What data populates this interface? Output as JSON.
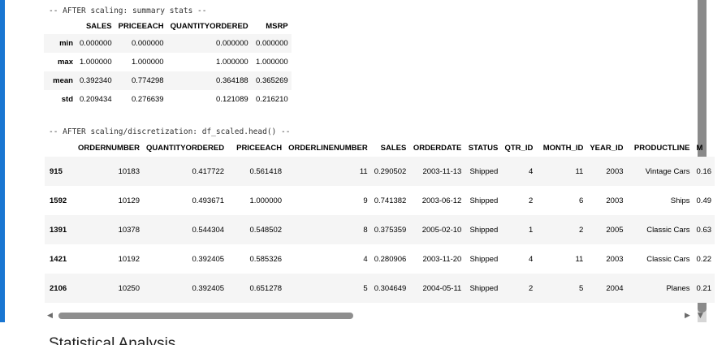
{
  "summary": {
    "label": "-- AFTER scaling: summary stats --",
    "columns": [
      "",
      "SALES",
      "PRICEEACH",
      "QUANTITYORDERED",
      "MSRP"
    ],
    "rows": [
      {
        "index": "min",
        "cells": [
          "0.000000",
          "0.000000",
          "0.000000",
          "0.000000"
        ]
      },
      {
        "index": "max",
        "cells": [
          "1.000000",
          "1.000000",
          "1.000000",
          "1.000000"
        ]
      },
      {
        "index": "mean",
        "cells": [
          "0.392340",
          "0.774298",
          "0.364188",
          "0.365269"
        ]
      },
      {
        "index": "std",
        "cells": [
          "0.209434",
          "0.276639",
          "0.121089",
          "0.216210"
        ]
      }
    ]
  },
  "head": {
    "label": "-- AFTER scaling/discretization: df_scaled.head() --",
    "columns": [
      "",
      "ORDERNUMBER",
      "QUANTITYORDERED",
      "PRICEEACH",
      "ORDERLINENUMBER",
      "SALES",
      "ORDERDATE",
      "STATUS",
      "QTR_ID",
      "MONTH_ID",
      "YEAR_ID",
      "PRODUCTLINE",
      "M"
    ],
    "rows": [
      {
        "index": "915",
        "cells": [
          "10183",
          "0.417722",
          "0.561418",
          "11",
          "0.290502",
          "2003-11-13",
          "Shipped",
          "4",
          "11",
          "2003",
          "Vintage Cars",
          "0.16"
        ]
      },
      {
        "index": "1592",
        "cells": [
          "10129",
          "0.493671",
          "1.000000",
          "9",
          "0.741382",
          "2003-06-12",
          "Shipped",
          "2",
          "6",
          "2003",
          "Ships",
          "0.49"
        ]
      },
      {
        "index": "1391",
        "cells": [
          "10378",
          "0.544304",
          "0.548502",
          "8",
          "0.375359",
          "2005-02-10",
          "Shipped",
          "1",
          "2",
          "2005",
          "Classic Cars",
          "0.63"
        ]
      },
      {
        "index": "1421",
        "cells": [
          "10192",
          "0.392405",
          "0.585326",
          "4",
          "0.280906",
          "2003-11-20",
          "Shipped",
          "4",
          "11",
          "2003",
          "Classic Cars",
          "0.22"
        ]
      },
      {
        "index": "2106",
        "cells": [
          "10250",
          "0.392405",
          "0.651278",
          "5",
          "0.304649",
          "2004-05-11",
          "Shipped",
          "2",
          "5",
          "2004",
          "Planes",
          "0.21"
        ]
      }
    ]
  },
  "icons": {
    "scroll_left": "◀",
    "scroll_right": "▶",
    "scroll_down": "▼"
  },
  "next_section": {
    "heading": "Statistical Analysis"
  },
  "colors": {
    "cell_accent": "#1976d2",
    "row_stripe": "#f5f5f5",
    "scrollbar_thumb": "#8e8e8e"
  }
}
